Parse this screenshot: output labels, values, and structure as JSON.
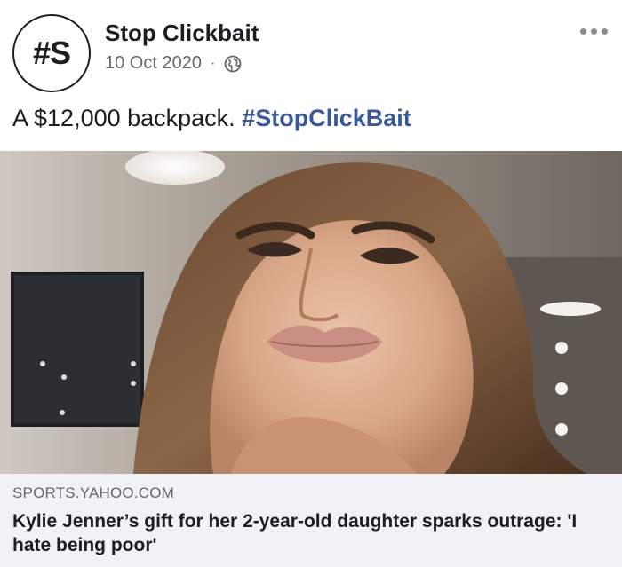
{
  "post": {
    "avatar_text": "#S",
    "page_name": "Stop Clickbait",
    "date": "10 Oct 2020",
    "separator": "·",
    "privacy_icon": "globe-icon",
    "more_icon": "more-options-icon",
    "text": "A $12,000 backpack.",
    "hashtag": "#StopClickBait"
  },
  "image": {
    "description_icon": "photo-of-woman"
  },
  "link_preview": {
    "domain": "SPORTS.YAHOO.COM",
    "title": "Kylie Jenner’s gift for her 2-year-old daughter sparks outrage: 'I hate being poor'"
  },
  "colors": {
    "hashtag": "#385898",
    "meta_text": "#65676b",
    "preview_background": "#f0f2f5"
  }
}
